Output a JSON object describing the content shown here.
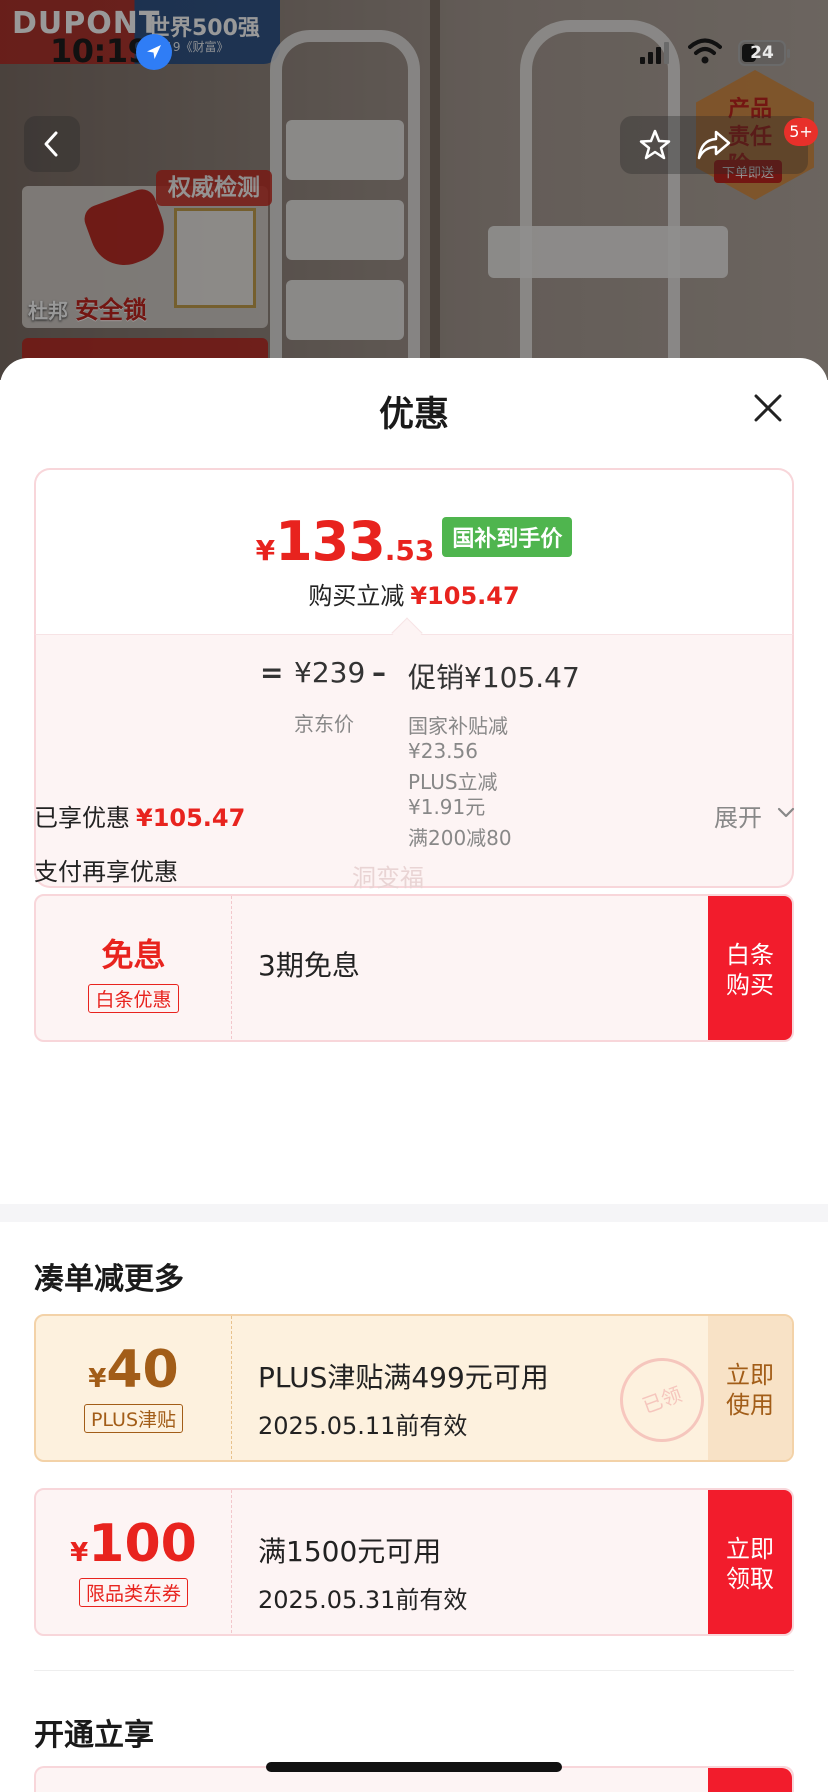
{
  "backdrop": {
    "brand": "DUPONT",
    "top500": "世界500强",
    "top500_sub": "2019《财富》",
    "badge_test": "权威检测",
    "lock_label_brand": "杜邦",
    "lock_label": "安全锁",
    "duty_badge": "产品责任险",
    "duty_sub": "下单即送"
  },
  "status_bar": {
    "time": "10:19",
    "battery": "24"
  },
  "nav": {
    "notification_count": "5+"
  },
  "sheet": {
    "title": "优惠"
  },
  "price_card": {
    "currency": "¥",
    "price_int": "133",
    "price_dec": ".53",
    "gov_tag": "国补到手价",
    "save_label": "购买立减",
    "save_amount": "¥105.47",
    "calc_eq": "=",
    "base_price": "¥239",
    "calc_minus": "–",
    "promo_total": "促销¥105.47",
    "base_label": "京东价",
    "sub_items": [
      "国家补贴减\n¥23.56",
      "PLUS立减\n¥1.91元",
      "满200减80"
    ],
    "ghost_mark": "洞变福"
  },
  "enjoyed": {
    "label": "已享优惠",
    "amount": "¥105.47",
    "expand": "展开"
  },
  "pay_more": {
    "label": "支付再享优惠"
  },
  "baitiao": {
    "main": "免息",
    "tag": "白条优惠",
    "title": "3期免息",
    "action": "白条\n购买"
  },
  "section_more": {
    "title": "凑单减更多"
  },
  "coupons": [
    {
      "currency": "¥",
      "amount": "40",
      "tag": "PLUS津贴",
      "title": "PLUS津贴满499元可用",
      "date": "2025.05.11前有效",
      "action": "立即\n使用",
      "stamp": "已领"
    },
    {
      "currency": "¥",
      "amount": "100",
      "tag": "限品类东券",
      "title": "满1500元可用",
      "date": "2025.05.31前有效",
      "action": "立即\n领取"
    }
  ],
  "section_open": {
    "title": "开通立享"
  },
  "colors": {
    "accent_red": "#e8231e",
    "button_red": "#f21c2c",
    "green_tag": "#4fb54e",
    "gold_text": "#a25d18"
  }
}
